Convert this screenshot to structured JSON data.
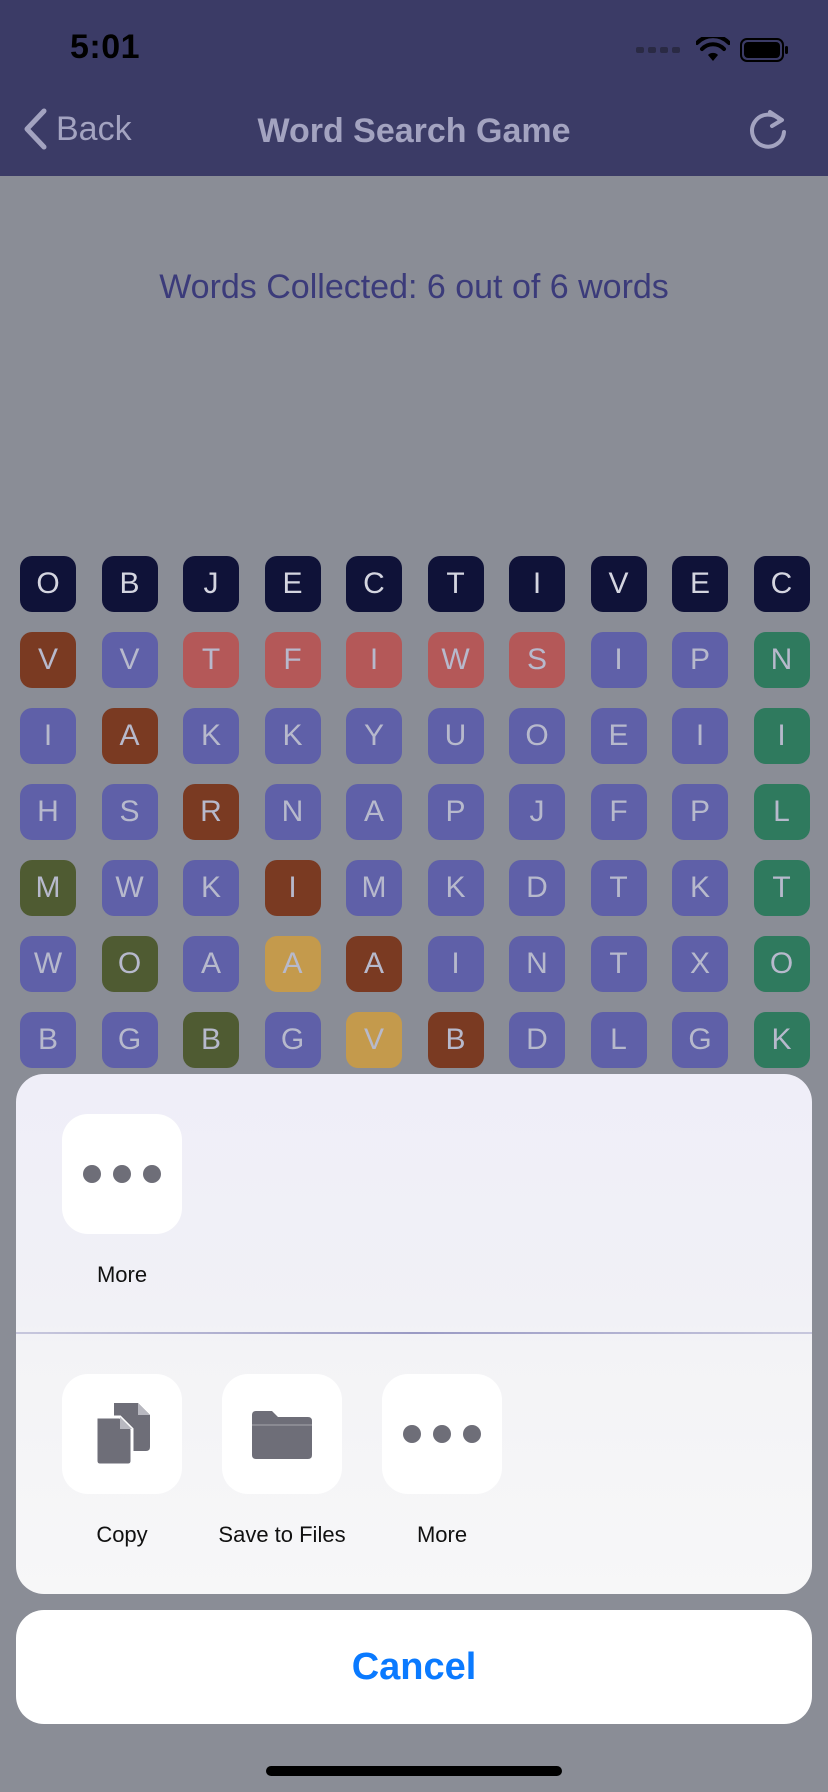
{
  "status_bar": {
    "time": "5:01"
  },
  "nav": {
    "back_label": "Back",
    "title": "Word Search Game"
  },
  "main": {
    "words_collected": "Words Collected: 6 out of 6 words"
  },
  "grid": {
    "rows": [
      [
        [
          "O",
          "#0f1238"
        ],
        [
          "B",
          "#0f1238"
        ],
        [
          "J",
          "#0f1238"
        ],
        [
          "E",
          "#0f1238"
        ],
        [
          "C",
          "#0f1238"
        ],
        [
          "T",
          "#0f1238"
        ],
        [
          "I",
          "#0f1238"
        ],
        [
          "V",
          "#0f1238"
        ],
        [
          "E",
          "#0f1238"
        ],
        [
          "C",
          "#0f1238"
        ]
      ],
      [
        [
          "V",
          "#7a3a22"
        ],
        [
          "V",
          "#5f60a8"
        ],
        [
          "T",
          "#b45858"
        ],
        [
          "F",
          "#b45858"
        ],
        [
          "I",
          "#b45858"
        ],
        [
          "W",
          "#b45858"
        ],
        [
          "S",
          "#b45858"
        ],
        [
          "I",
          "#5f60a8"
        ],
        [
          "P",
          "#5f60a8"
        ],
        [
          "N",
          "#2f7a5e"
        ]
      ],
      [
        [
          "I",
          "#5f60a8"
        ],
        [
          "A",
          "#7a3a22"
        ],
        [
          "K",
          "#5f60a8"
        ],
        [
          "K",
          "#5f60a8"
        ],
        [
          "Y",
          "#5f60a8"
        ],
        [
          "U",
          "#5f60a8"
        ],
        [
          "O",
          "#5f60a8"
        ],
        [
          "E",
          "#5f60a8"
        ],
        [
          "I",
          "#5f60a8"
        ],
        [
          "I",
          "#2f7a5e"
        ]
      ],
      [
        [
          "H",
          "#5f60a8"
        ],
        [
          "S",
          "#5f60a8"
        ],
        [
          "R",
          "#7a3a22"
        ],
        [
          "N",
          "#5f60a8"
        ],
        [
          "A",
          "#5f60a8"
        ],
        [
          "P",
          "#5f60a8"
        ],
        [
          "J",
          "#5f60a8"
        ],
        [
          "F",
          "#5f60a8"
        ],
        [
          "P",
          "#5f60a8"
        ],
        [
          "L",
          "#2f7a5e"
        ]
      ],
      [
        [
          "M",
          "#4f5b32"
        ],
        [
          "W",
          "#5f60a8"
        ],
        [
          "K",
          "#5f60a8"
        ],
        [
          "I",
          "#7a3a22"
        ],
        [
          "M",
          "#5f60a8"
        ],
        [
          "K",
          "#5f60a8"
        ],
        [
          "D",
          "#5f60a8"
        ],
        [
          "T",
          "#5f60a8"
        ],
        [
          "K",
          "#5f60a8"
        ],
        [
          "T",
          "#2f7a5e"
        ]
      ],
      [
        [
          "W",
          "#5f60a8"
        ],
        [
          "O",
          "#4f5b32"
        ],
        [
          "A",
          "#5f60a8"
        ],
        [
          "A",
          "#c49a4c"
        ],
        [
          "A",
          "#7a3a22"
        ],
        [
          "I",
          "#5f60a8"
        ],
        [
          "N",
          "#5f60a8"
        ],
        [
          "T",
          "#5f60a8"
        ],
        [
          "X",
          "#5f60a8"
        ],
        [
          "O",
          "#2f7a5e"
        ]
      ],
      [
        [
          "B",
          "#5f60a8"
        ],
        [
          "G",
          "#5f60a8"
        ],
        [
          "B",
          "#4f5b32"
        ],
        [
          "G",
          "#5f60a8"
        ],
        [
          "V",
          "#c49a4c"
        ],
        [
          "B",
          "#7a3a22"
        ],
        [
          "D",
          "#5f60a8"
        ],
        [
          "L",
          "#5f60a8"
        ],
        [
          "G",
          "#5f60a8"
        ],
        [
          "K",
          "#2f7a5e"
        ]
      ]
    ]
  },
  "share_sheet": {
    "top_actions": [
      {
        "label": "More",
        "icon": "more-icon"
      }
    ],
    "bottom_actions": [
      {
        "label": "Copy",
        "icon": "copy-icon"
      },
      {
        "label": "Save to Files",
        "icon": "folder-icon"
      },
      {
        "label": "More",
        "icon": "more-icon"
      }
    ],
    "cancel_label": "Cancel"
  },
  "colors": {
    "nav_bg": "#3b3b66",
    "dim_bg": "#8a8d96",
    "accent": "#0a7aff",
    "cell_dark": "#0f1238",
    "cell_default": "#5f60a8",
    "word_brown": "#7a3a22",
    "word_red": "#b45858",
    "word_green": "#2f7a5e",
    "word_olive": "#4f5b32",
    "word_gold": "#c49a4c"
  }
}
